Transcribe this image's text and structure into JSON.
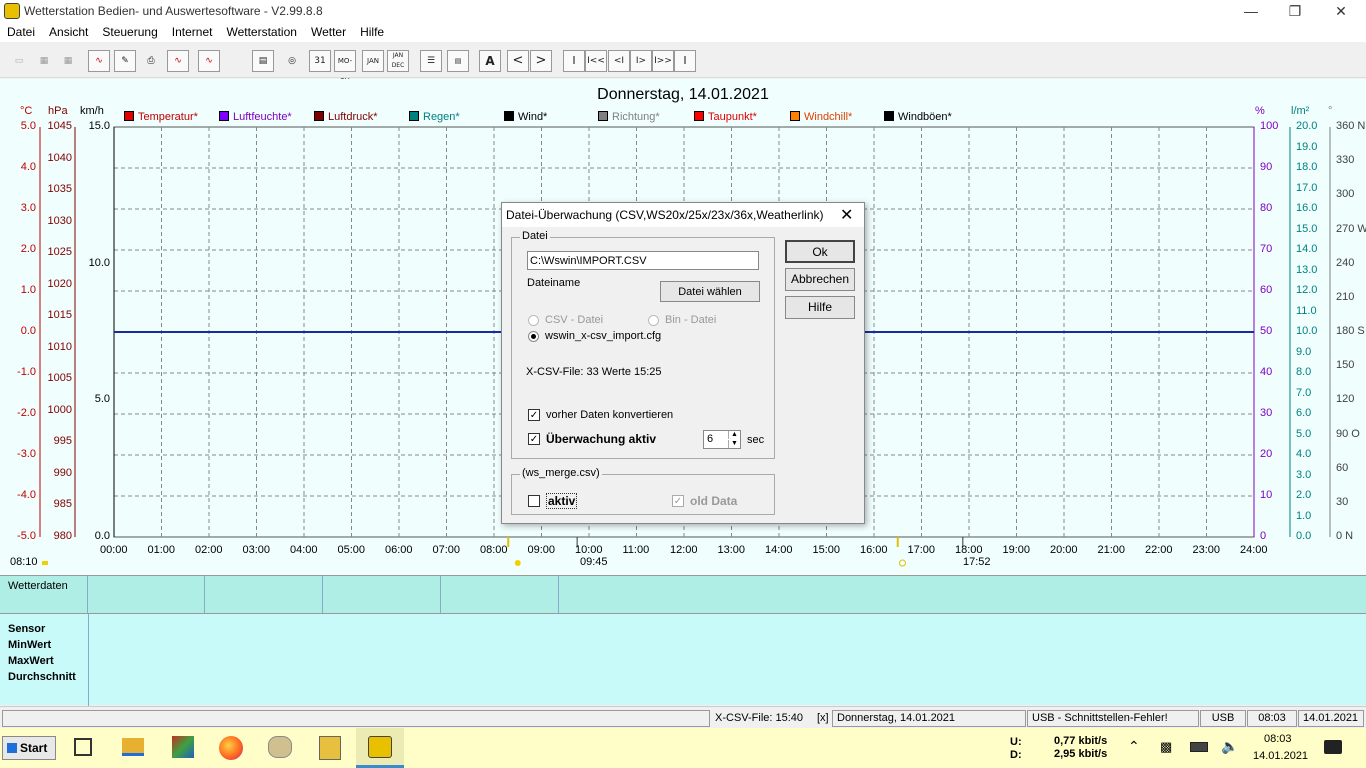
{
  "window": {
    "title": "Wetterstation Bedien- und Auswertesoftware - V2.99.8.8"
  },
  "menu": [
    "Datei",
    "Ansicht",
    "Steuerung",
    "Internet",
    "Wetterstation",
    "Wetter",
    "Hilfe"
  ],
  "toolbar": {
    "btn_31": "31",
    "btn_mo_su": "MO-SU",
    "btn_jan": "JAN",
    "btn_jan_dec": "JAN DEC",
    "btn_a": "A",
    "btn_prev": "<",
    "btn_next": ">",
    "btn_first": "I",
    "btn_rew": "I<<",
    "btn_back": "<I",
    "btn_fwd": "I>",
    "btn_ff": "I>>",
    "btn_last": "I"
  },
  "chart": {
    "date_title": "Donnerstag, 14.01.2021",
    "units_left": [
      "°C",
      "hPa",
      "km/h"
    ],
    "units_right": [
      "%",
      "l/m²",
      "°"
    ],
    "legend": [
      {
        "label": "Temperatur*",
        "color": "#e00000",
        "text": "#c00000"
      },
      {
        "label": "Luftfeuchte*",
        "color": "#8000ff",
        "text": "#8000c0"
      },
      {
        "label": "Luftdruck*",
        "color": "#800000",
        "text": "#800000"
      },
      {
        "label": "Regen*",
        "color": "#008080",
        "text": "#008080"
      },
      {
        "label": "Wind*",
        "color": "#000000",
        "text": "#000000"
      },
      {
        "label": "Richtung*",
        "color": "#808080",
        "text": "#808080"
      },
      {
        "label": "Taupunkt*",
        "color": "#ff0000",
        "text": "#e00000"
      },
      {
        "label": "Windchill*",
        "color": "#ff8000",
        "text": "#e04000"
      },
      {
        "label": "Windböen*",
        "color": "#000000",
        "text": "#000000"
      }
    ],
    "axis_temp": [
      "5.0",
      "4.0",
      "3.0",
      "2.0",
      "1.0",
      "0.0",
      "-1.0",
      "-2.0",
      "-3.0",
      "-4.0",
      "-5.0"
    ],
    "axis_press": [
      "1045",
      "1040",
      "1035",
      "1030",
      "1025",
      "1020",
      "1015",
      "1010",
      "1005",
      "1000",
      "995",
      "990",
      "985",
      "980"
    ],
    "axis_wind": [
      "15.0",
      "10.0",
      "5.0",
      "0.0"
    ],
    "axis_hum": [
      "100",
      "90",
      "80",
      "70",
      "60",
      "50",
      "40",
      "30",
      "20",
      "10",
      "0"
    ],
    "axis_rain": [
      "20.0",
      "19.0",
      "18.0",
      "17.0",
      "16.0",
      "15.0",
      "14.0",
      "13.0",
      "12.0",
      "11.0",
      "10.0",
      "9.0",
      "8.0",
      "7.0",
      "6.0",
      "5.0",
      "4.0",
      "3.0",
      "2.0",
      "1.0",
      "0.0"
    ],
    "axis_dir": [
      "360 N",
      "330",
      "300",
      "270 W",
      "240",
      "210",
      "180 S",
      "150",
      "120",
      "90  O",
      "60",
      "30",
      "0   N"
    ],
    "x_ticks": [
      "00:00",
      "01:00",
      "02:00",
      "03:00",
      "04:00",
      "05:00",
      "06:00",
      "07:00",
      "08:00",
      "09:00",
      "10:00",
      "11:00",
      "12:00",
      "13:00",
      "14:00",
      "15:00",
      "16:00",
      "17:00",
      "18:00",
      "19:00",
      "20:00",
      "21:00",
      "22:00",
      "23:00",
      "24:00"
    ],
    "time_left": "08:10",
    "sunrise": "09:45",
    "sunset": "17:52"
  },
  "panels": {
    "wetterdaten": "Wetterdaten",
    "rows": [
      "Sensor",
      "MinWert",
      "MaxWert",
      "Durchschnitt"
    ]
  },
  "status": {
    "xcsv": "X-CSV-File:   15:40",
    "x": "[x]",
    "date": "Donnerstag, 14.01.2021",
    "usb_error": "USB - Schnittstellen-Fehler!",
    "usb": "USB",
    "time": "08:03",
    "date2": "14.01.2021"
  },
  "taskbar": {
    "start": "Start",
    "net_u_label": "U:",
    "net_d_label": "D:",
    "net_u": "0,77 kbit/s",
    "net_d": "2,95 kbit/s",
    "clock_time": "08:03",
    "clock_date": "14.01.2021"
  },
  "dialog": {
    "title": "Datei-Überwachung (CSV,WS20x/25x/23x/36x,Weatherlink)",
    "group_datei": "Datei",
    "path": "C:\\Wswin\\IMPORT.CSV",
    "dateiname": "Dateiname",
    "datei_waehlen": "Datei wählen",
    "csv_datei": "CSV - Datei",
    "bin_datei": "Bin - Datei",
    "cfg": "wswin_x-csv_import.cfg",
    "xcsv_info": "X-CSV-File:  33 Werte   15:25",
    "vorher": "vorher Daten konvertieren",
    "ueberwachung": "Überwachung aktiv",
    "sec_value": "6",
    "sec": "sec",
    "group_merge": "(ws_merge.csv)",
    "aktiv": "aktiv",
    "old_data": "old Data",
    "ok": "Ok",
    "abbrechen": "Abbrechen",
    "hilfe": "Hilfe"
  }
}
